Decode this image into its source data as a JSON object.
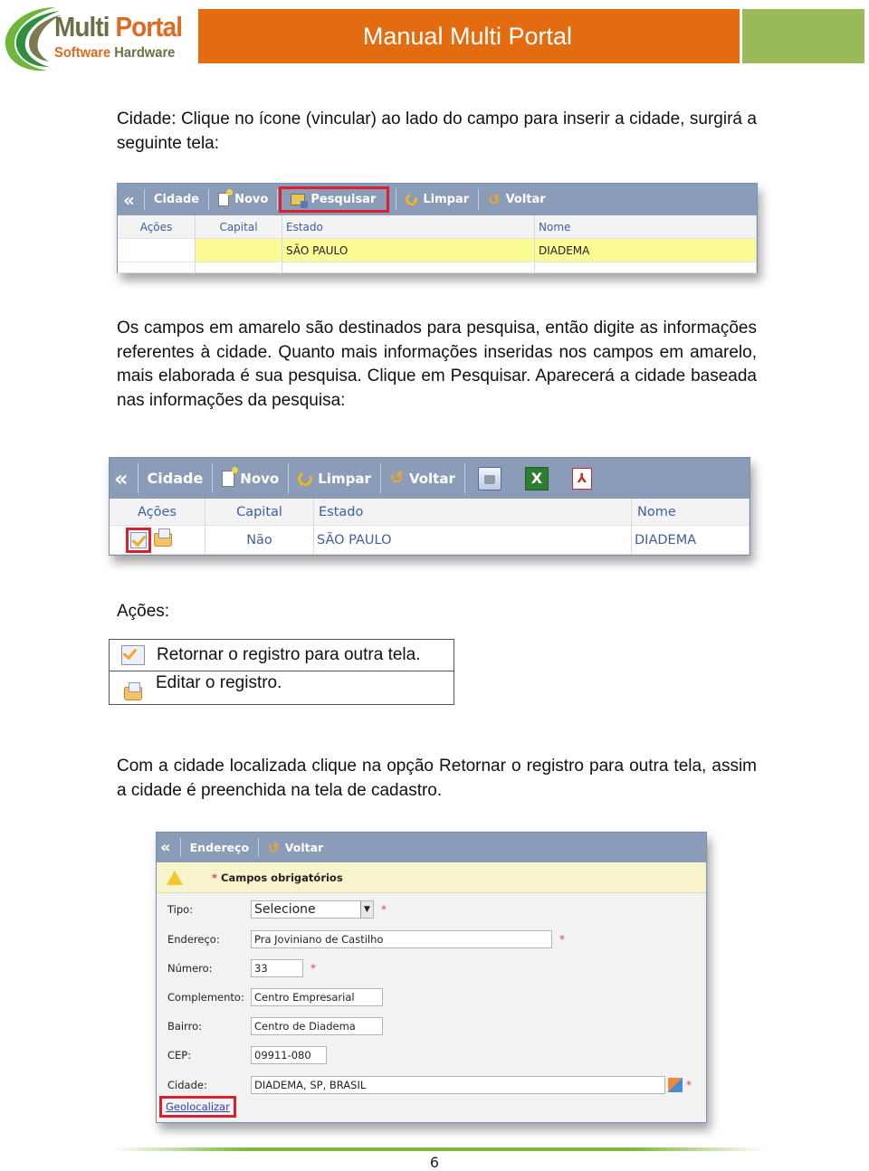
{
  "header": {
    "logo": {
      "word1": "Multi",
      "word2": "Portal",
      "word3": "Software",
      "word4": "Hardware"
    },
    "title": "Manual Multi Portal",
    "colors": {
      "orange": "#e36b10",
      "green": "#9aba5a"
    }
  },
  "paragraphs": {
    "p1": "Cidade: Clique no ícone (vincular) ao lado do campo para inserir a cidade, surgirá a seguinte tela:",
    "p2": "Os campos em amarelo são destinados para pesquisa, então digite as informações referentes à cidade. Quanto mais informações inseridas nos campos em amarelo, mais elaborada é sua pesquisa. Clique em Pesquisar. Aparecerá a cidade baseada nas informações da pesquisa:",
    "p3_label": "Ações:",
    "p4": "Com a cidade localizada clique na opção Retornar o registro para outra tela, assim a cidade é preenchida na tela de cadastro."
  },
  "screen1": {
    "toolbar": {
      "collapse": "«",
      "title": "Cidade",
      "novo": "Novo",
      "pesquisar": "Pesquisar",
      "limpar": "Limpar",
      "voltar": "Voltar"
    },
    "columns": [
      "Ações",
      "Capital",
      "Estado",
      "Nome"
    ],
    "search_row": {
      "acoes": "",
      "capital": "",
      "estado": "SÃO PAULO",
      "nome": "DIADEMA"
    }
  },
  "screen2": {
    "toolbar": {
      "collapse": "«",
      "title": "Cidade",
      "novo": "Novo",
      "limpar": "Limpar",
      "voltar": "Voltar",
      "excel_glyph": "X",
      "pdf_glyph": "⅄"
    },
    "columns": [
      "Ações",
      "Capital",
      "Estado",
      "Nome"
    ],
    "rows": [
      {
        "capital": "Não",
        "estado": "SÃO PAULO",
        "nome": "DIADEMA"
      }
    ]
  },
  "actions_legend": [
    {
      "icon": "checkbox-return-icon",
      "text": "Retornar o registro para outra tela."
    },
    {
      "icon": "folder-edit-icon",
      "text": "Editar o registro."
    }
  ],
  "screen3": {
    "toolbar": {
      "collapse": "«",
      "title": "Endereço",
      "voltar": "Voltar"
    },
    "notice": "Campos obrigatórios",
    "required_mark": "*",
    "fields": {
      "tipo": {
        "label": "Tipo:",
        "value": "Selecione"
      },
      "endereco": {
        "label": "Endereço:",
        "value": "Pra Joviniano de Castilho"
      },
      "numero": {
        "label": "Número:",
        "value": "33"
      },
      "complemento": {
        "label": "Complemento:",
        "value": "Centro Empresarial"
      },
      "bairro": {
        "label": "Bairro:",
        "value": "Centro de Diadema"
      },
      "cep": {
        "label": "CEP:",
        "value": "09911-080"
      },
      "cidade": {
        "label": "Cidade:",
        "value": "DIADEMA, SP, BRASIL"
      }
    },
    "geolocalizar": "Geolocalizar"
  },
  "footer": {
    "page_number": "6"
  }
}
